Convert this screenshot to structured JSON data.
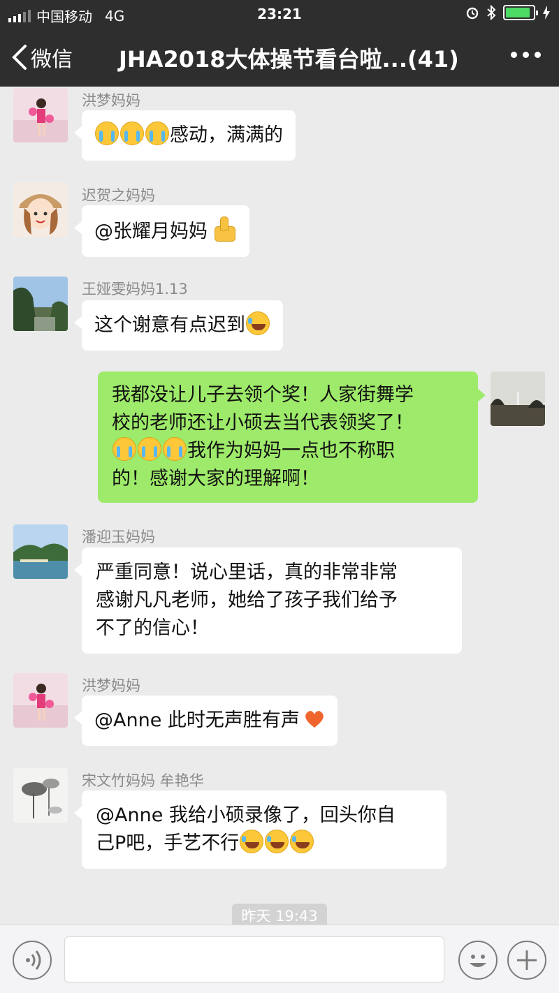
{
  "status_bar": {
    "carrier": "中国移动",
    "network": "4G",
    "time": "23:21",
    "battery_level": 0.9
  },
  "nav": {
    "back_label": "微信",
    "title": "JHA2018大体操节看台啦...(41)"
  },
  "messages": [
    {
      "sender": "洪梦妈妈",
      "text": "感动，满满的",
      "emojis": [
        "crying-face",
        "crying-face",
        "crying-face"
      ]
    },
    {
      "sender": "迟贺之妈妈",
      "text": "@张耀月妈妈",
      "emojis": [
        "thumbs-up"
      ]
    },
    {
      "sender": "王娅雯妈妈1.13",
      "text": "这个谢意有点迟到",
      "emojis": [
        "laughing-crying-face"
      ]
    },
    {
      "sender": "",
      "outgoing": true,
      "line1": "我都没让儿子去领个奖！人家街舞学",
      "line2": "校的老师还让小硕去当代表领奖了！",
      "line3": "我作为妈妈一点也不称职",
      "line4": "的！感谢大家的理解啊！",
      "emojis": [
        "crying-face",
        "crying-face",
        "crying-face"
      ]
    },
    {
      "sender": "潘迎玉妈妈",
      "line1": "严重同意！说心里话，真的非常非常",
      "line2": "感谢凡凡老师，她给了孩子我们给予",
      "line3": "不了的信心！"
    },
    {
      "sender": "洪梦妈妈",
      "text": "@Anne 此时无声胜有声",
      "emojis": [
        "heart"
      ]
    },
    {
      "sender": "宋文竹妈妈 牟艳华",
      "line1": "@Anne 我给小硕录像了，回头你自",
      "line2": "己P吧，手艺不行",
      "emojis": [
        "laughing-crying-face",
        "laughing-crying-face",
        "laughing-crying-face"
      ]
    }
  ],
  "timestamp": "昨天 19:43",
  "input": {
    "voice_icon": "voice-icon",
    "emoji_icon": "smiley-icon",
    "plus_icon": "plus-icon"
  },
  "colors": {
    "bar_bg": "#2e2e2e",
    "chat_bg": "#ebebeb",
    "outgoing_bubble": "#9eea6a",
    "incoming_bubble": "#ffffff"
  }
}
